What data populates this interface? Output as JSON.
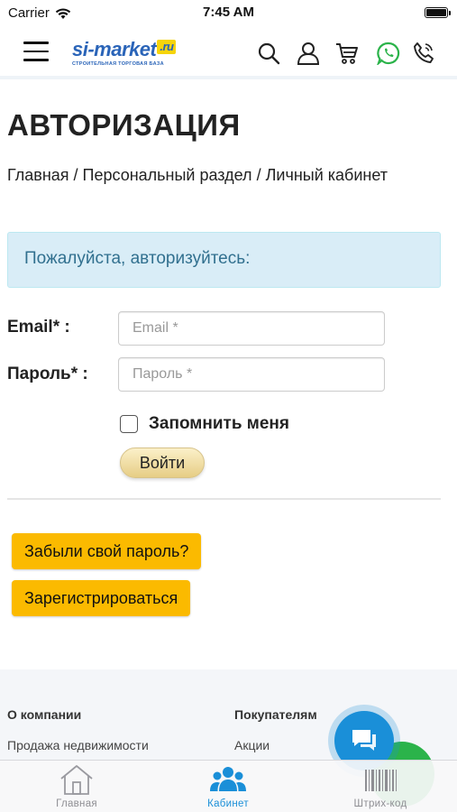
{
  "status": {
    "carrier": "Carrier",
    "time": "7:45 AM"
  },
  "header": {
    "logo_main": "si-market",
    "logo_ru": ".ru",
    "logo_sub": "СТРОИТЕЛЬНАЯ ТОРГОВАЯ БАЗА",
    "icons": [
      "menu-icon",
      "search-icon",
      "user-icon",
      "cart-icon",
      "whatsapp-icon",
      "phone-icon"
    ],
    "whatsapp_color": "#2bb34a"
  },
  "page": {
    "title": "АВТОРИЗАЦИЯ",
    "breadcrumb": [
      "Главная",
      "Персональный раздел",
      "Личный кабинет"
    ],
    "breadcrumb_separator": " / ",
    "alert": "Пожалуйста, авторизуйтесь:"
  },
  "form": {
    "email_label": "Email* :",
    "email_placeholder": "Email *",
    "password_label": "Пароль* :",
    "password_placeholder": "Пароль *",
    "remember_label": "Запомнить меня",
    "login_button": "Войти"
  },
  "actions": {
    "forgot_password": "Забыли свой пароль?",
    "register": "Зарегистрироваться",
    "button_color": "#fbba00"
  },
  "footer": {
    "col1_title": "О компании",
    "col1_link": "Продажа недвижимости",
    "col2_title": "Покупателям",
    "col2_link": "Акции"
  },
  "tabbar": {
    "items": [
      {
        "label": "Главная",
        "icon": "home-icon",
        "active": false
      },
      {
        "label": "Кабинет",
        "icon": "users-icon",
        "active": true
      },
      {
        "label": "Штрих-код",
        "icon": "barcode-icon",
        "active": false
      }
    ],
    "active_color": "#1a8fd8",
    "inactive_color": "#8e8e93"
  },
  "colors": {
    "brand_blue": "#2a64b8",
    "brand_yellow": "#f6d40b",
    "alert_bg": "#d9edf7",
    "alert_text": "#31708f"
  }
}
